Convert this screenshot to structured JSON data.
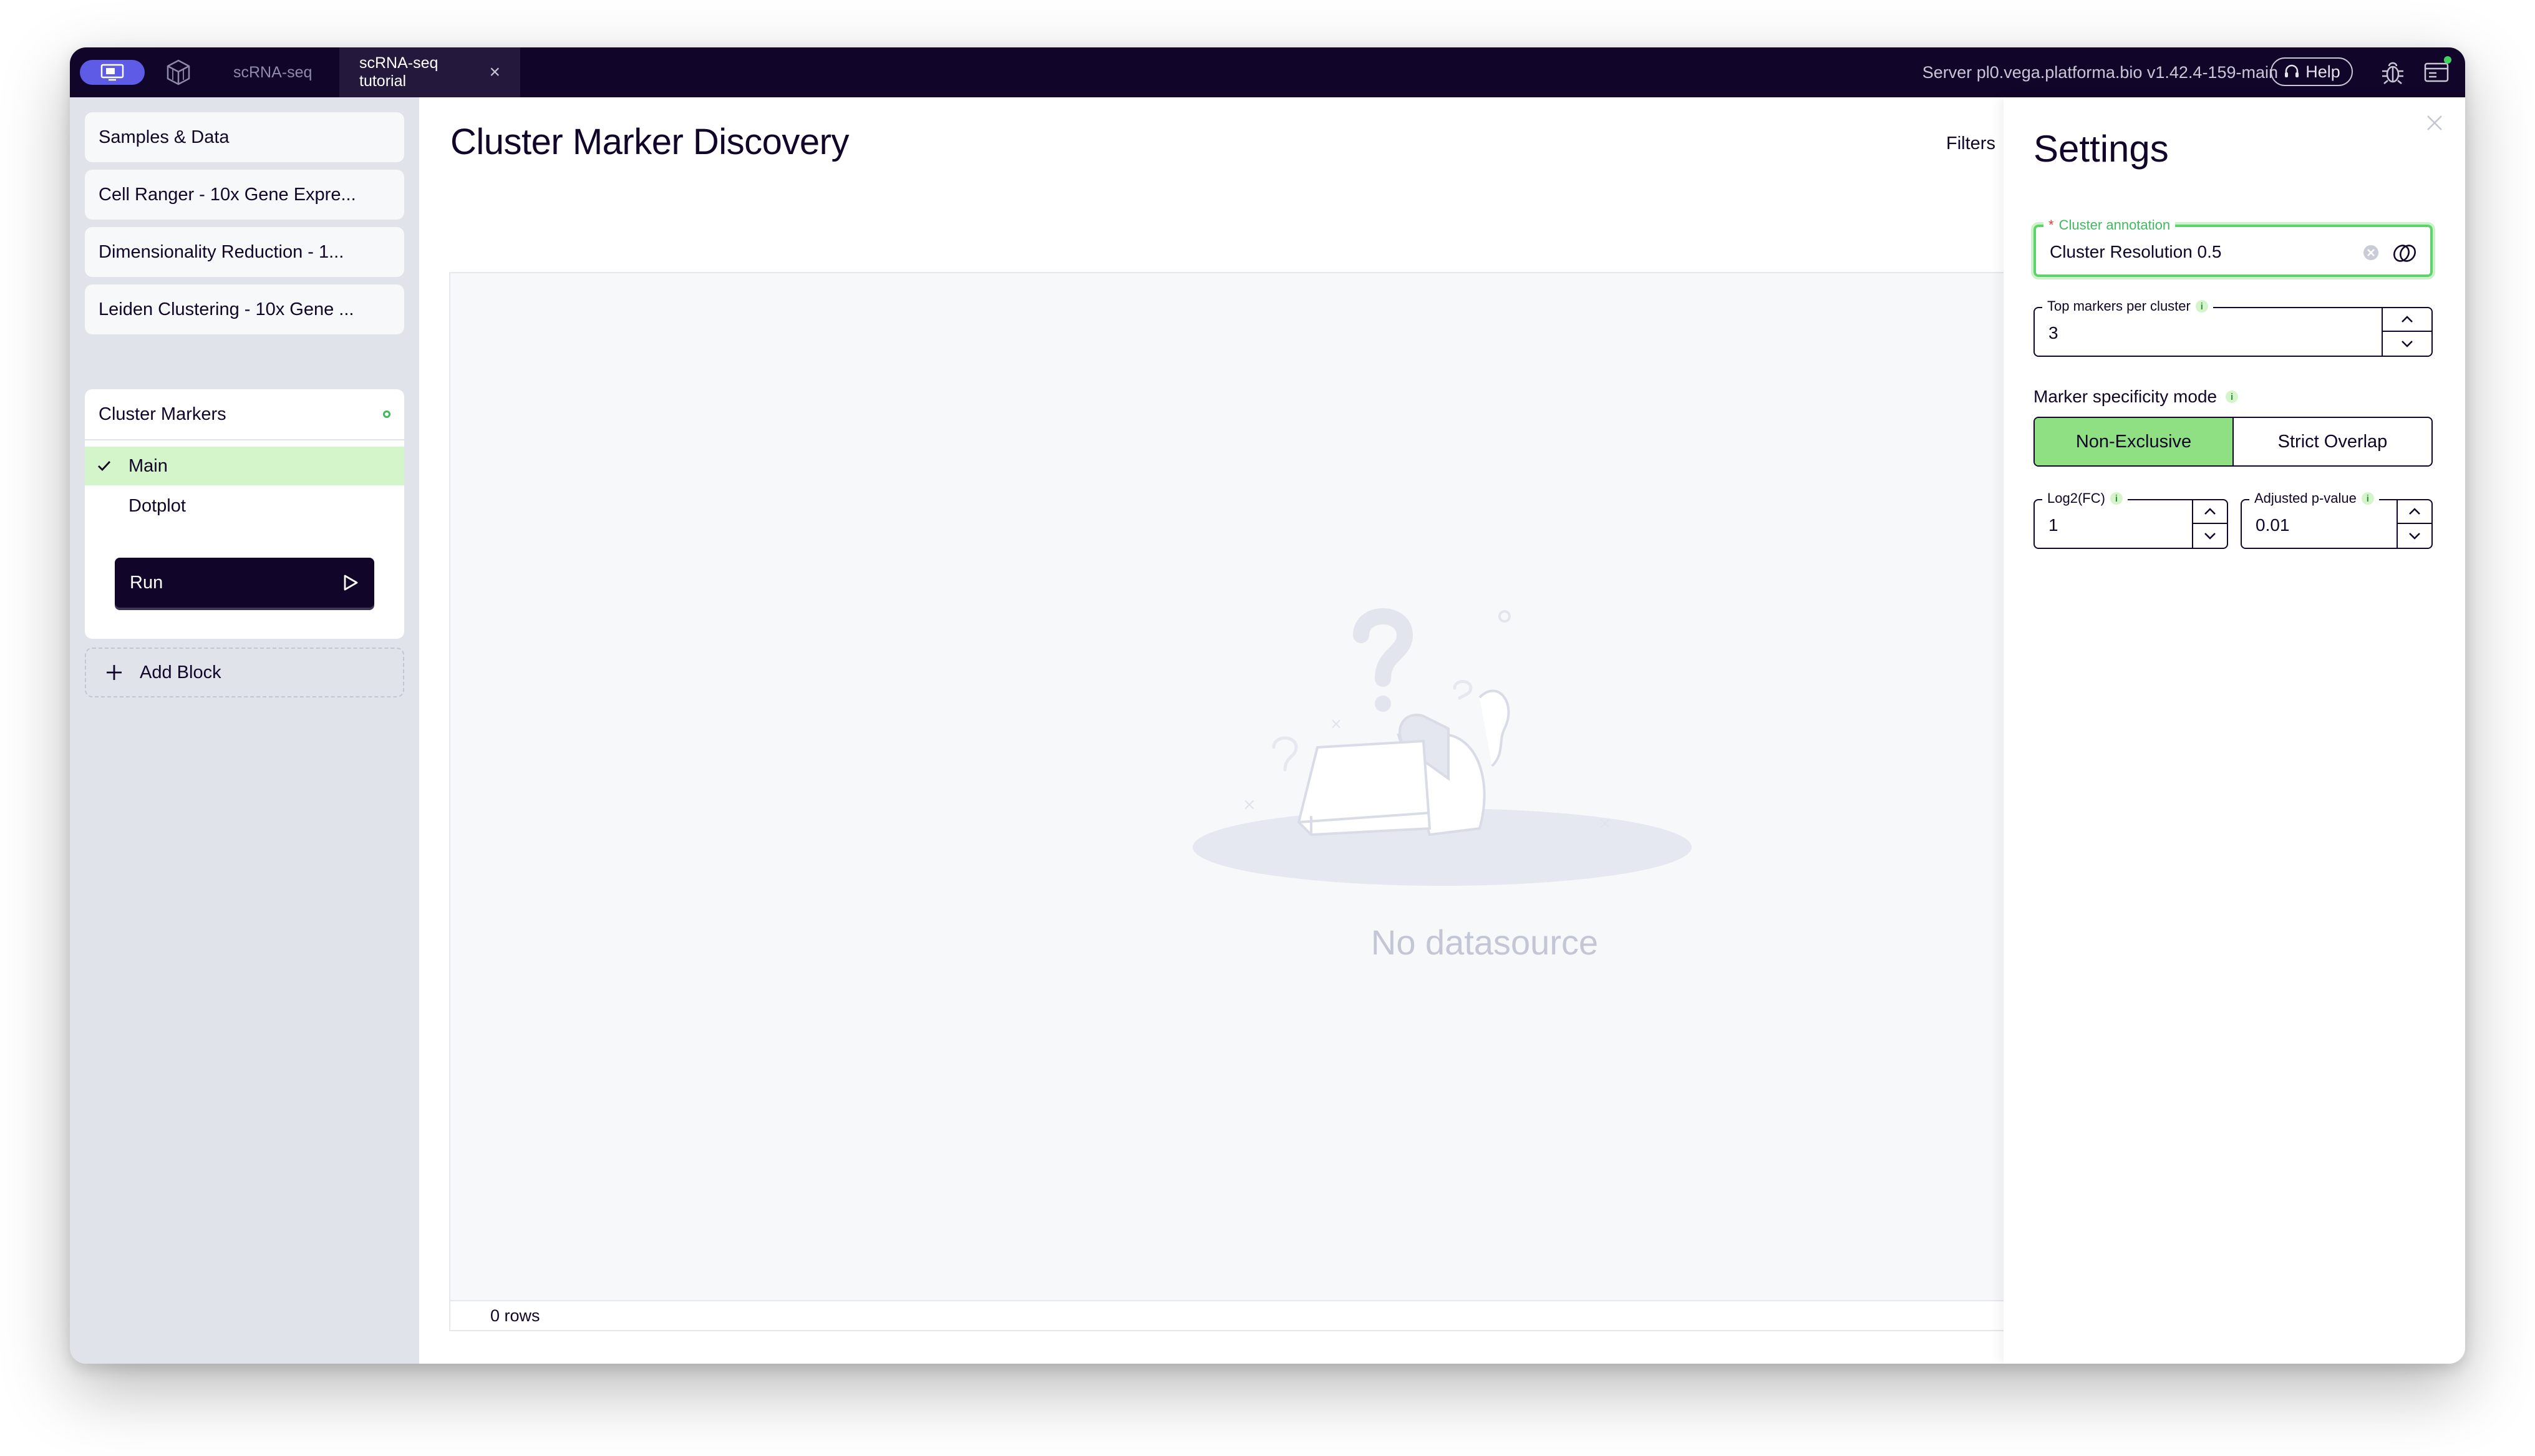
{
  "titlebar": {
    "tabs": [
      {
        "label": "scRNA-seq"
      },
      {
        "label": "scRNA-seq tutorial"
      }
    ],
    "server": "Server pl0.vega.platforma.bio v1.42.4-159-main",
    "help_label": "Help"
  },
  "sidebar": {
    "blocks": [
      {
        "label": "Samples & Data"
      },
      {
        "label": "Cell Ranger - 10x Gene Expre..."
      },
      {
        "label": "Dimensionality Reduction - 1..."
      },
      {
        "label": "Leiden Clustering - 10x Gene ..."
      }
    ],
    "active_block": {
      "label": "Cluster Markers",
      "subitems": [
        {
          "label": "Main",
          "selected": true
        },
        {
          "label": "Dotplot",
          "selected": false
        }
      ],
      "run_label": "Run"
    },
    "add_block_label": "Add Block"
  },
  "main": {
    "title": "Cluster Marker Discovery",
    "filters_label": "Filters",
    "empty_message": "No datasource",
    "row_count": "0 rows"
  },
  "settings": {
    "title": "Settings",
    "cluster_annotation": {
      "label": "Cluster annotation",
      "required_mark": "*",
      "value": "Cluster Resolution 0.5"
    },
    "top_markers": {
      "label": "Top markers per cluster",
      "value": "3"
    },
    "mode": {
      "label": "Marker specificity mode",
      "options": [
        "Non-Exclusive",
        "Strict Overlap"
      ],
      "selected": "Non-Exclusive"
    },
    "log2fc": {
      "label": "Log2(FC)",
      "value": "1"
    },
    "padj": {
      "label": "Adjusted p-value",
      "value": "0.01"
    }
  },
  "colors": {
    "titlebar_bg": "#110529",
    "accent_purple": "#5e5ce6",
    "accent_green": "#8ee082",
    "selected_green": "#d4f5c9",
    "sidebar_bg": "#e1e3eb"
  }
}
